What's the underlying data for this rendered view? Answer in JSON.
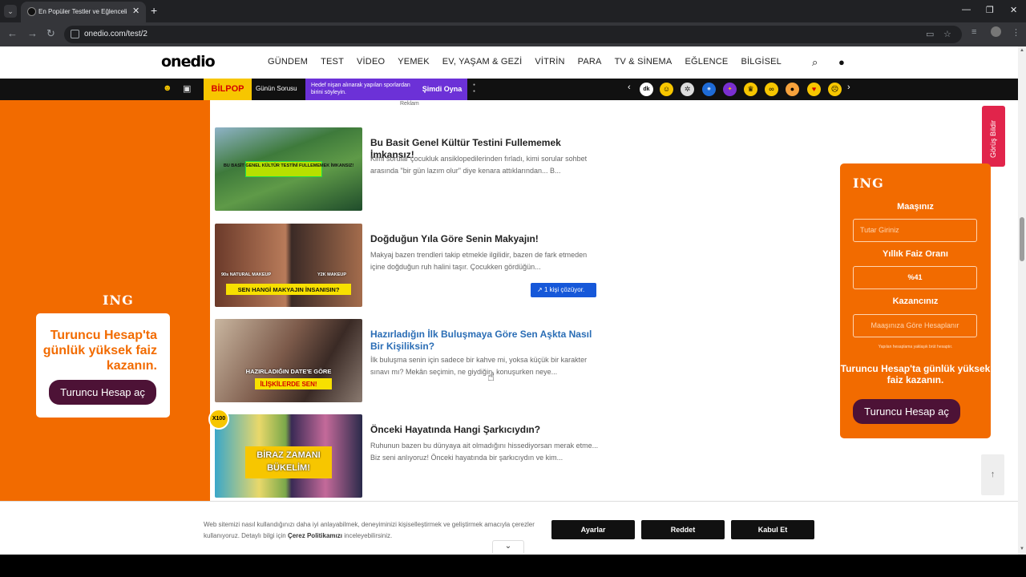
{
  "browser": {
    "tab_title": "En Popüler Testler ve Eğlenceli İ",
    "url": "onedio.com/test/2"
  },
  "header": {
    "logo": "onedio",
    "menu": [
      "GÜNDEM",
      "TEST",
      "VİDEO",
      "YEMEK",
      "EV, YAŞAM & GEZİ",
      "VİTRİN",
      "PARA",
      "TV & SİNEMA",
      "EĞLENCE",
      "BİLGİSEL"
    ]
  },
  "subbar": {
    "bilpop": "BİLPOP",
    "daily_question_label": "Günün Sorusu",
    "question": "Hedef nişan alınarak yapılan sporlardan birini söyleyin.",
    "play_label": "Şimdi Oyna"
  },
  "ad_left": {
    "brand": "ING",
    "text": "Turuncu Hesap'ta günlük yüksek faiz kazanın.",
    "button": "Turuncu Hesap aç"
  },
  "reklam_label": "Reklam",
  "articles": [
    {
      "title": "Bu Basit Genel Kültür Testini Fullememek İmkansız!",
      "desc": "Kimi sorular çocukluk ansiklopedilerinden fırladı, kimi sorular sohbet arasında \"bir gün lazım olur\" diye kenara attıklarından... B...",
      "thumb_text": "BU BASİT GENEL KÜLTÜR TESTİNİ FULLEMEMEK İMKANSIZ!"
    },
    {
      "title": "Doğduğun Yıla Göre Senin Makyajın!",
      "desc": "Makyaj bazen trendleri takip etmekle ilgilidir, bazen de fark etmeden içine doğduğun ruh halini taşır. Çocukken gördüğün...",
      "thumb_text": "SEN HANGİ MAKYAJIN İNSANISIN?",
      "thumb_left": "90s NATURAL MAKEUP",
      "thumb_right": "Y2K MAKEUP",
      "badge": "1 kişi çözüyor."
    },
    {
      "title": "Hazırladığın İlk Buluşmaya Göre Sen Aşkta Nasıl Bir Kişiliksin?",
      "desc": "İlk buluşma senin için sadece bir kahve mi, yoksa küçük bir karakter sınavı mı? Mekân seçimin, ne giydiğin, konuşurken neye...",
      "thumb_text": "HAZIRLADIĞIN DATE'E GÖRE",
      "thumb_text2": "İLİŞKİLERDE SEN!"
    },
    {
      "title": "Önceki Hayatında Hangi Şarkıcıydın?",
      "desc": "Ruhunun bazen bu dünyaya ait olmadığını hissediyorsan merak etme... Biz seni anlıyoruz! Önceki hayatında bir şarkıcıydın ve kim...",
      "thumb_text": "BİRAZ ZAMANI BÜKELİM!",
      "badge": "X100"
    }
  ],
  "feedback_label": "Görüş Bildir",
  "ad_right": {
    "brand": "ING",
    "salary_label": "Maaşınız",
    "salary_placeholder": "Tutar Giriniz",
    "rate_label": "Yıllık Faiz Oranı",
    "rate_value": "%41",
    "earnings_label": "Kazancınız",
    "earnings_placeholder": "Maaşınıza Göre Hesaplanır",
    "note": "Yapılan hesaplama yaklaşık brüt hesaptır.",
    "promo": "Turuncu Hesap'ta günlük yüksek faiz kazanın.",
    "button": "Turuncu Hesap aç"
  },
  "cookie": {
    "text": "Web sitemizi nasıl kullandığınızı daha iyi anlayabilmek, deneyiminizi kişiselleştirmek ve geliştirmek amacıyla çerezler kullanıyoruz. Detaylı bilgi için",
    "link": "Çerez Politikamızı",
    "text_end": "inceleyebilirsiniz.",
    "settings": "Ayarlar",
    "reject": "Reddet",
    "accept": "Kabul Et"
  },
  "colors": {
    "brand_orange": "#f26b00",
    "ing_button": "#4d1236",
    "bilpop_yellow": "#f7c600",
    "question_purple": "#6c31d7",
    "badge_blue": "#1658d9",
    "feedback_red": "#e1244b"
  }
}
